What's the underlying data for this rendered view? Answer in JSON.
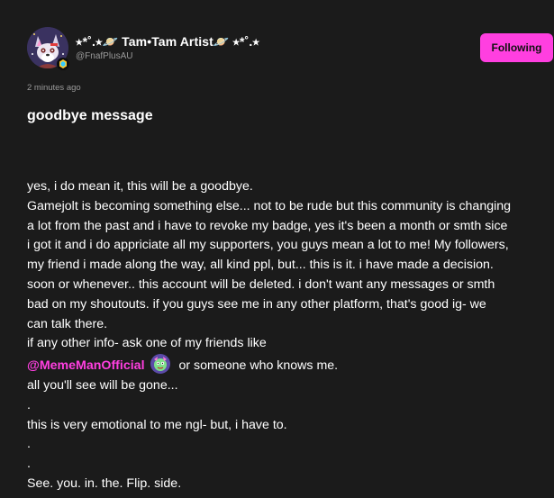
{
  "author": {
    "display_name": "⭑*˚.⭑🪐 Tam•Tam Artist🪐 ⭑*˚.⭑",
    "username": "@FnafPlusAU",
    "avatar_icon": "fox-avatar-icon",
    "badge_icon": "verified-badge-icon"
  },
  "follow_button": {
    "label": "Following",
    "color": "#ff3fe0"
  },
  "post": {
    "timestamp": "2 minutes ago",
    "title": "goodbye message",
    "body": {
      "line1": "yes, i do mean it, this will be a goodbye.",
      "line2": "Gamejolt is becoming something else... not to be rude but this community is changing",
      "line3": "a lot from the past and i have to revoke my badge, yes it's been a month or smth sice",
      "line4": "i got it and i do appriciate all my supporters, you guys mean a lot to me! My followers,",
      "line5": "my friend i made along the way, all kind ppl, but... this is it. i have made a decision.",
      "line6": "soon or whenever.. this account will be deleted. i don't want any messages or smth",
      "line7": "bad on my shoutouts. if you guys see me in any other platform, that's good ig- we",
      "line8": "can talk there.",
      "line9": "if any other info- ask one of my friends like",
      "mention": "@MemeManOfficial",
      "mention_suffix": " or someone who knows me.",
      "line11": "all you'll see will be gone...",
      "dot1": ".",
      "line13": "this is very emotional to me ngl- but, i have to.",
      "dot2": ".",
      "dot3": ".",
      "line16": "See. you. in. the. Flip. side."
    }
  },
  "colors": {
    "background": "#1b1b1b",
    "accent": "#ff3fe0",
    "muted_text": "#9a9a9a"
  }
}
